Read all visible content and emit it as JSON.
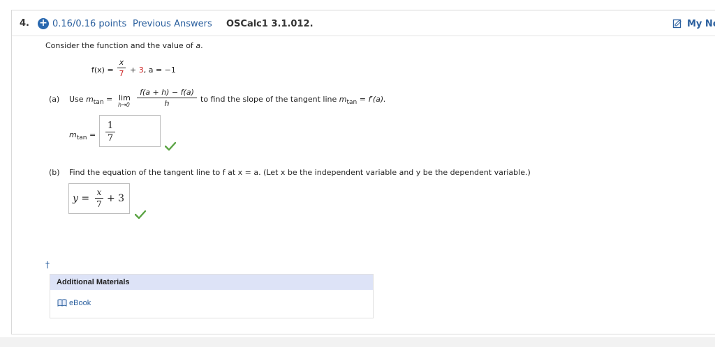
{
  "header": {
    "question_number": "4.",
    "points": "0.16/0.16 points",
    "previous_answers": "Previous Answers",
    "problem_code": "OSCalc1 3.1.012.",
    "my_notes": "My No"
  },
  "prompt": {
    "text_before": "Consider the function and the value of ",
    "var_a": "a",
    "text_after": "."
  },
  "function_def": {
    "lhs": "f(x) =",
    "frac_num": "x",
    "frac_den": "7",
    "plus": "+",
    "const": "3",
    "a_part": ", a = −1"
  },
  "part_a": {
    "label": "(a)",
    "use": "Use",
    "m": "m",
    "tan": "tan",
    "equals": "=",
    "lim": "lim",
    "lim_sub": "h→0",
    "frac_num": "f(a + h) − f(a)",
    "frac_den": "h",
    "text": "to find the slope of the tangent line",
    "rhs": "= f′(a).",
    "answer_label_eq": "=",
    "answer_num": "1",
    "answer_den": "7"
  },
  "part_b": {
    "label": "(b)",
    "text": "Find the equation of the tangent line to f at x = a. (Let x be the independent variable and y be the dependent variable.)",
    "answer_lhs": "y =",
    "answer_num": "x",
    "answer_den": "7",
    "answer_rest": "+ 3"
  },
  "dagger": "†",
  "additional_materials": {
    "title": "Additional Materials",
    "ebook": "eBook"
  },
  "colors": {
    "link": "#2a5f9e",
    "accent_blue": "#2a69b0",
    "check_green": "#5aa343",
    "materials_bg": "#dde3f7",
    "highlight_red": "#cc2222"
  }
}
